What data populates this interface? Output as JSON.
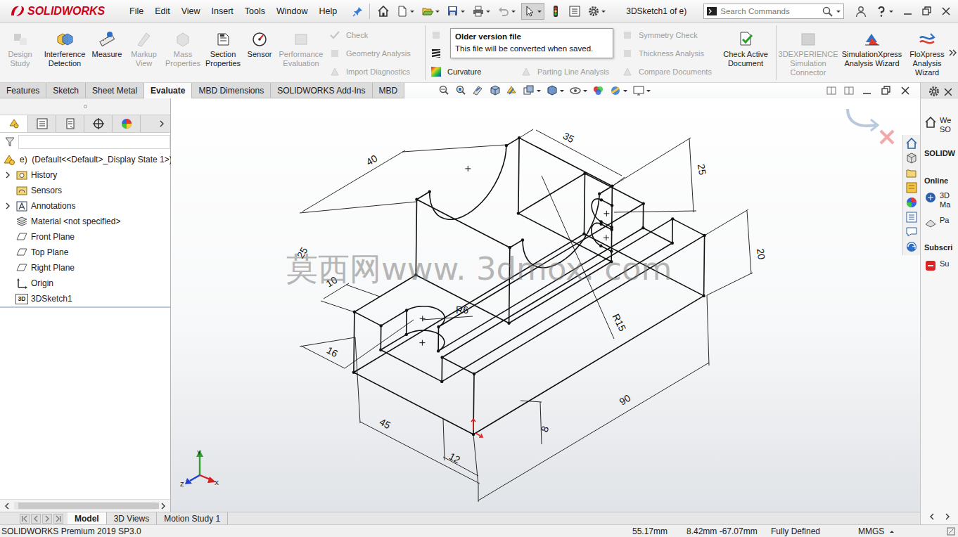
{
  "app": {
    "logo": "SOLIDWORKS"
  },
  "menu": [
    {
      "label": "File"
    },
    {
      "label": "Edit"
    },
    {
      "label": "View"
    },
    {
      "label": "Insert"
    },
    {
      "label": "Tools"
    },
    {
      "label": "Window"
    },
    {
      "label": "Help"
    }
  ],
  "window": {
    "title": "3DSketch1 of e)"
  },
  "search": {
    "placeholder": "Search Commands"
  },
  "ribbon": {
    "items": [
      {
        "kind": "large",
        "lines": [
          "Design",
          "Study"
        ],
        "disabled": true
      },
      {
        "kind": "large",
        "lines": [
          "Interference",
          "Detection"
        ],
        "disabled": false
      },
      {
        "kind": "large",
        "lines": [
          "Measure"
        ],
        "disabled": false
      },
      {
        "kind": "large",
        "lines": [
          "Markup",
          "View"
        ],
        "disabled": true
      },
      {
        "kind": "large",
        "lines": [
          "Mass",
          "Properties"
        ],
        "disabled": true
      },
      {
        "kind": "large",
        "lines": [
          "Section",
          "Properties"
        ],
        "disabled": false
      },
      {
        "kind": "large",
        "lines": [
          "Sensor"
        ],
        "disabled": false
      },
      {
        "kind": "large",
        "lines": [
          "Performance",
          "Evaluation"
        ],
        "disabled": true
      },
      {
        "kind": "stack",
        "rows": [
          {
            "label": "Check",
            "disabled": true
          },
          {
            "label": "Geometry Analysis",
            "disabled": true
          },
          {
            "label": "Import Diagnostics",
            "disabled": true
          }
        ]
      },
      {
        "kind": "separator"
      },
      {
        "kind": "stack",
        "rows": [
          {
            "disabled": true
          },
          {
            "disabled": false
          },
          {
            "label": "Curvature",
            "disabled": false
          }
        ]
      },
      {
        "kind": "stack",
        "rows": [
          {
            "disabled": true
          },
          {
            "disabled": true
          },
          {
            "label": "Parting Line Analysis",
            "disabled": true
          }
        ]
      },
      {
        "kind": "stack",
        "rows": [
          {
            "label": "Symmetry Check",
            "disabled": true
          },
          {
            "label": "Thickness Analysis",
            "disabled": true
          },
          {
            "label": "Compare Documents",
            "disabled": true
          }
        ]
      },
      {
        "kind": "large",
        "lines": [
          "Check Active",
          "Document"
        ],
        "disabled": false
      },
      {
        "kind": "separator"
      },
      {
        "kind": "large",
        "lines": [
          "3DEXPERIENCE",
          "Simulation",
          "Connector"
        ],
        "disabled": true
      },
      {
        "kind": "large",
        "lines": [
          "SimulationXpress",
          "Analysis Wizard"
        ],
        "disabled": false
      },
      {
        "kind": "large",
        "lines": [
          "FloXpress",
          "Analysis",
          "Wizard"
        ],
        "disabled": false
      },
      {
        "kind": "more"
      }
    ]
  },
  "tooltip": {
    "title": "Older version file",
    "text": "This file will be converted when saved."
  },
  "tabs": [
    {
      "label": "Features",
      "selected": false
    },
    {
      "label": "Sketch",
      "selected": false
    },
    {
      "label": "Sheet Metal",
      "selected": false
    },
    {
      "label": "Evaluate",
      "selected": true
    },
    {
      "label": "MBD Dimensions",
      "selected": false
    },
    {
      "label": "SOLIDWORKS Add-Ins",
      "selected": false
    },
    {
      "label": "MBD",
      "selected": false
    }
  ],
  "feature_tree": {
    "root": "e)  (Default<<Default>_Display State 1>)",
    "items": [
      {
        "label": "History",
        "expandable": true
      },
      {
        "label": "Sensors",
        "expandable": false
      },
      {
        "label": "Annotations",
        "expandable": true
      },
      {
        "label": "Material <not specified>",
        "expandable": false
      },
      {
        "label": "Front Plane",
        "expandable": false
      },
      {
        "label": "Top Plane",
        "expandable": false
      },
      {
        "label": "Right Plane",
        "expandable": false
      },
      {
        "label": "Origin",
        "expandable": false
      },
      {
        "label": "3DSketch1",
        "expandable": false,
        "icon_text": "3D"
      }
    ]
  },
  "sketch": {
    "dimensions": [
      "40",
      "35",
      "25",
      "20",
      "R6",
      "R15",
      "10",
      "25",
      "16",
      "45",
      "12",
      "8",
      "90"
    ],
    "watermark": "莫西网www. 3dmox. com",
    "triad": {
      "x": "X",
      "y": "Y",
      "z": "Z"
    }
  },
  "task_pane": {
    "items": [
      {
        "kind": "link",
        "lines": [
          "We",
          "SO"
        ]
      },
      {
        "kind": "heading",
        "lines": [
          "SOLIDW"
        ]
      },
      {
        "kind": "heading",
        "lines": [
          "Online"
        ]
      },
      {
        "kind": "link",
        "lines": [
          "3D",
          "Ma"
        ]
      },
      {
        "kind": "link",
        "lines": [
          "Pa"
        ]
      },
      {
        "kind": "heading",
        "lines": [
          "Subscri"
        ]
      },
      {
        "kind": "link",
        "lines": [
          "Su"
        ]
      }
    ]
  },
  "bottom_tabs": [
    {
      "label": "Model",
      "selected": true
    },
    {
      "label": "3D Views",
      "selected": false
    },
    {
      "label": "Motion Study 1",
      "selected": false
    }
  ],
  "status_bar": {
    "product": "SOLIDWORKS Premium 2019 SP3.0",
    "fields": [
      "55.17mm",
      "8.42mm -67.07mm",
      "Fully Defined",
      "MMGS"
    ]
  }
}
